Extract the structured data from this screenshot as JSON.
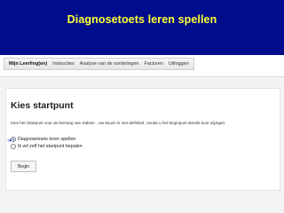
{
  "slide": {
    "title": "Diagnosetoets leren spellen"
  },
  "nav": {
    "items": [
      "Mijn Leerling(en)",
      "Instructies",
      "Analyse van de vorderingen",
      "Facturen",
      "Uitloggen"
    ]
  },
  "panel": {
    "title": "Kies startpunt",
    "description": "Kies het Startpunt voor de leerweg van Sabine . Uw keuze is niet definitief, omdat u het beginpunt steeds kunt wijzigen.",
    "options": [
      {
        "label": "Diagnosetoets leren spellen",
        "selected": true
      },
      {
        "label": "Ik wil zelf het startpunt bepalen",
        "selected": false
      }
    ],
    "begin_label": "Begin"
  },
  "colors": {
    "header_bg": "#000c8c",
    "title_text": "#ffff33"
  }
}
